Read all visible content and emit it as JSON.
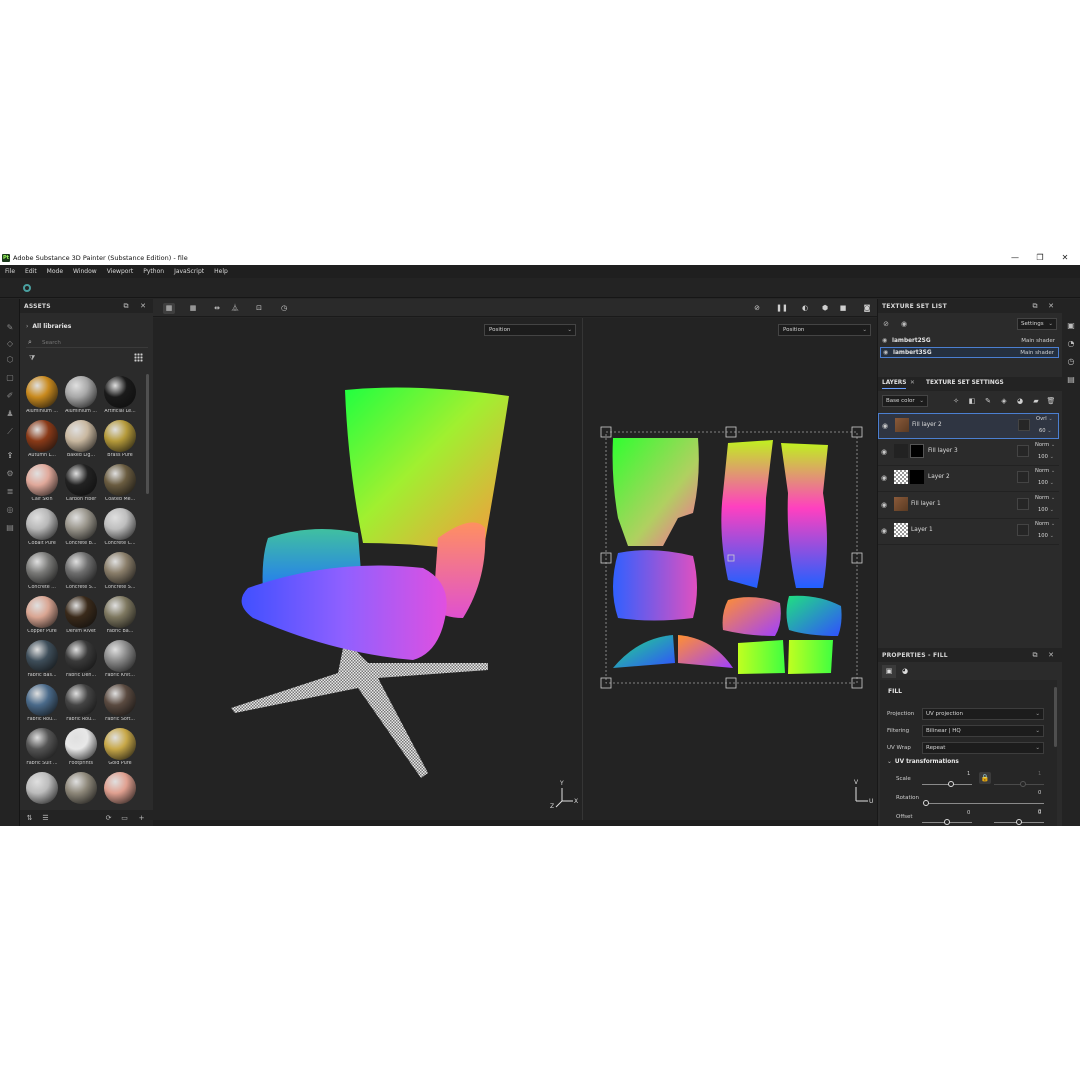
{
  "window": {
    "title": "Adobe Substance 3D Painter (Substance Edition) - file",
    "logo": "Pt",
    "controls": {
      "minimize": "—",
      "restore": "❐",
      "close": "✕"
    }
  },
  "menu": [
    "File",
    "Edit",
    "Mode",
    "Window",
    "Viewport",
    "Python",
    "JavaScript",
    "Help"
  ],
  "assets": {
    "title": "ASSETS",
    "library": "All libraries",
    "search_placeholder": "Search",
    "items": [
      {
        "label": "Aluminium ...",
        "color": "#c98a1e"
      },
      {
        "label": "Aluminium ...",
        "color": "#a8a8a8"
      },
      {
        "label": "Artificial Le...",
        "color": "#1a1a1a"
      },
      {
        "label": "Autumn L...",
        "color": "#8a3a18"
      },
      {
        "label": "Baked Lig...",
        "color": "#c9b8a0"
      },
      {
        "label": "Brass Pure",
        "color": "#b59a3a"
      },
      {
        "label": "Calf Skin",
        "color": "#e0a89a"
      },
      {
        "label": "Carbon Fiber",
        "color": "#222222"
      },
      {
        "label": "Coated Me...",
        "color": "#6a5c40"
      },
      {
        "label": "Cobalt Pure",
        "color": "#b8b8b8"
      },
      {
        "label": "Concrete B...",
        "color": "#9a968c"
      },
      {
        "label": "Concrete C...",
        "color": "#bebebe"
      },
      {
        "label": "Concrete ...",
        "color": "#7a7a78"
      },
      {
        "label": "Concrete S...",
        "color": "#6e6e6e"
      },
      {
        "label": "Concrete S...",
        "color": "#8a7e6a"
      },
      {
        "label": "Copper Pure",
        "color": "#d9a592"
      },
      {
        "label": "Denim Rivet",
        "color": "#3a2a1a"
      },
      {
        "label": "Fabric Ba...",
        "color": "#7e7860"
      },
      {
        "label": "Fabric Bas...",
        "color": "#3e4e5a"
      },
      {
        "label": "Fabric Den...",
        "color": "#3a3a3a"
      },
      {
        "label": "Fabric Knit...",
        "color": "#8a8a8a"
      },
      {
        "label": "Fabric Rou...",
        "color": "#4a6a8a"
      },
      {
        "label": "Fabric Rou...",
        "color": "#444444"
      },
      {
        "label": "Fabric Soft...",
        "color": "#5a4a40"
      },
      {
        "label": "Fabric Suit ...",
        "color": "#555555"
      },
      {
        "label": "Footprints",
        "color": "#e8e8e8"
      },
      {
        "label": "Gold Pure",
        "color": "#c8a848"
      },
      {
        "label": "",
        "color": "#bcbcbc"
      },
      {
        "label": "",
        "color": "#8e887a"
      },
      {
        "label": "",
        "color": "#e0a090"
      }
    ]
  },
  "viewport": {
    "left_mode": "Position",
    "right_mode": "Position",
    "axes_3d": {
      "x": "X",
      "y": "Y",
      "z": "Z"
    },
    "axes_uv": {
      "u": "U",
      "v": "V"
    }
  },
  "texture_set_list": {
    "title": "TEXTURE SET LIST",
    "settings_label": "Settings",
    "sets": [
      {
        "name": "lambert2SG",
        "shader": "Main shader",
        "selected": false
      },
      {
        "name": "lambert3SG",
        "shader": "Main shader",
        "selected": true
      }
    ]
  },
  "layers_panel": {
    "tab_layers": "LAYERS",
    "tab_settings": "TEXTURE SET SETTINGS",
    "channel": "Base color",
    "layers": [
      {
        "name": "Fill layer 2",
        "blend": "Ovrl",
        "opacity": "60",
        "thumb": "fill",
        "mask": false,
        "selected": true
      },
      {
        "name": "Fill layer 3",
        "blend": "Norm",
        "opacity": "100",
        "thumb": "black",
        "mask": true,
        "selected": false
      },
      {
        "name": "Layer 2",
        "blend": "Norm",
        "opacity": "100",
        "thumb": "check",
        "mask": true,
        "selected": false
      },
      {
        "name": "Fill layer 1",
        "blend": "Norm",
        "opacity": "100",
        "thumb": "fill",
        "mask": false,
        "selected": false
      },
      {
        "name": "Layer 1",
        "blend": "Norm",
        "opacity": "100",
        "thumb": "check",
        "mask": false,
        "selected": false
      }
    ]
  },
  "properties": {
    "title": "PROPERTIES - FILL",
    "section": "FILL",
    "projection_label": "Projection",
    "projection_value": "UV projection",
    "filtering_label": "Filtering",
    "filtering_value": "Bilinear | HQ",
    "wrap_label": "UV Wrap",
    "wrap_value": "Repeat",
    "uv_transform_title": "UV transformations",
    "scale_label": "Scale",
    "scale_value": "1",
    "scale_value_locked": "1",
    "scale_value_2": "0",
    "rotation_label": "Rotation",
    "rotation_value": "0",
    "offset_label": "Offset",
    "offset_x": "0",
    "offset_y": "0"
  }
}
